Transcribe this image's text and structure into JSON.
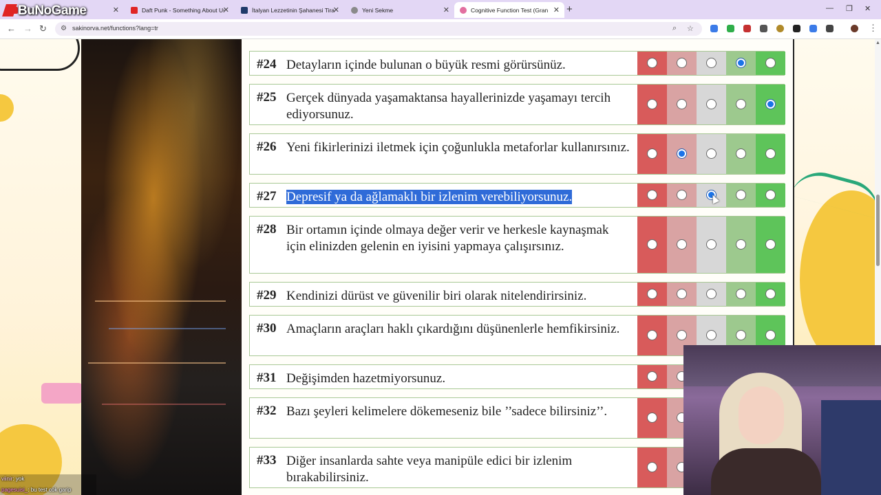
{
  "browser": {
    "tabs": [
      {
        "title": "Bu No Game",
        "active": false,
        "favicon": "red"
      },
      {
        "title": "Daft Punk - Something About Us",
        "active": false,
        "favicon": "red"
      },
      {
        "title": "İtalyan Lezzetinin Şahanesi Tiramisu",
        "active": false,
        "favicon": "dark-blue"
      },
      {
        "title": "Yeni Sekme",
        "active": false,
        "favicon": "gray"
      },
      {
        "title": "Cognitive Function Test (Grant/Br",
        "active": true,
        "favicon": "pink"
      }
    ],
    "url": "sakinorva.net/functions?lang=tr"
  },
  "overlay": {
    "logo": "BuNoGame",
    "chat": [
      {
        "user": "viinir",
        "message": ": yok"
      },
      {
        "user": "pagesuisi_",
        "message": ": bu test cok garip"
      }
    ]
  },
  "colors": {
    "strongly_disagree": "#d85b5b",
    "disagree": "#d9a3a3",
    "neutral": "#d7d7d7",
    "agree": "#9dc98e",
    "strongly_agree": "#5ec45a",
    "highlight": "#2f6bd8"
  },
  "questions": [
    {
      "num": "#24",
      "text": "Detayların içinde bulunan o büyük resmi görürsünüz.",
      "selected": 4,
      "highlighted": false
    },
    {
      "num": "#25",
      "text": "Gerçek dünyada yaşamaktansa hayallerinizde yaşamayı tercih ediyorsunuz.",
      "selected": 5,
      "highlighted": false
    },
    {
      "num": "#26",
      "text": "Yeni fikirlerinizi iletmek için çoğunlukla metaforlar kullanırsınız.",
      "selected": 2,
      "highlighted": false
    },
    {
      "num": "#27",
      "text": "Depresif ya da ağlamaklı bir izlenim verebiliyorsunuz.",
      "selected": 3,
      "highlighted": true
    },
    {
      "num": "#28",
      "text": "Bir ortamın içinde olmaya değer verir ve herkesle kaynaşmak için elinizden gelenin en iyisini yapmaya çalışırsınız.",
      "selected": 0,
      "highlighted": false
    },
    {
      "num": "#29",
      "text": "Kendinizi dürüst ve güvenilir biri olarak nitelendirirsiniz.",
      "selected": 0,
      "highlighted": false
    },
    {
      "num": "#30",
      "text": "Amaçların araçları haklı çıkardığını düşünenlerle hemfikirsiniz.",
      "selected": 0,
      "highlighted": false
    },
    {
      "num": "#31",
      "text": "Değişimden hazetmiyorsunuz.",
      "selected": 0,
      "highlighted": false
    },
    {
      "num": "#32",
      "text": "Bazı şeyleri kelimelere dökemeseniz bile ’’sadece bilirsiniz’’.",
      "selected": 0,
      "highlighted": false
    },
    {
      "num": "#33",
      "text": "Diğer insanlarda sahte veya manipüle edici bir izlenim bırakabilirsiniz.",
      "selected": 0,
      "highlighted": false
    }
  ]
}
